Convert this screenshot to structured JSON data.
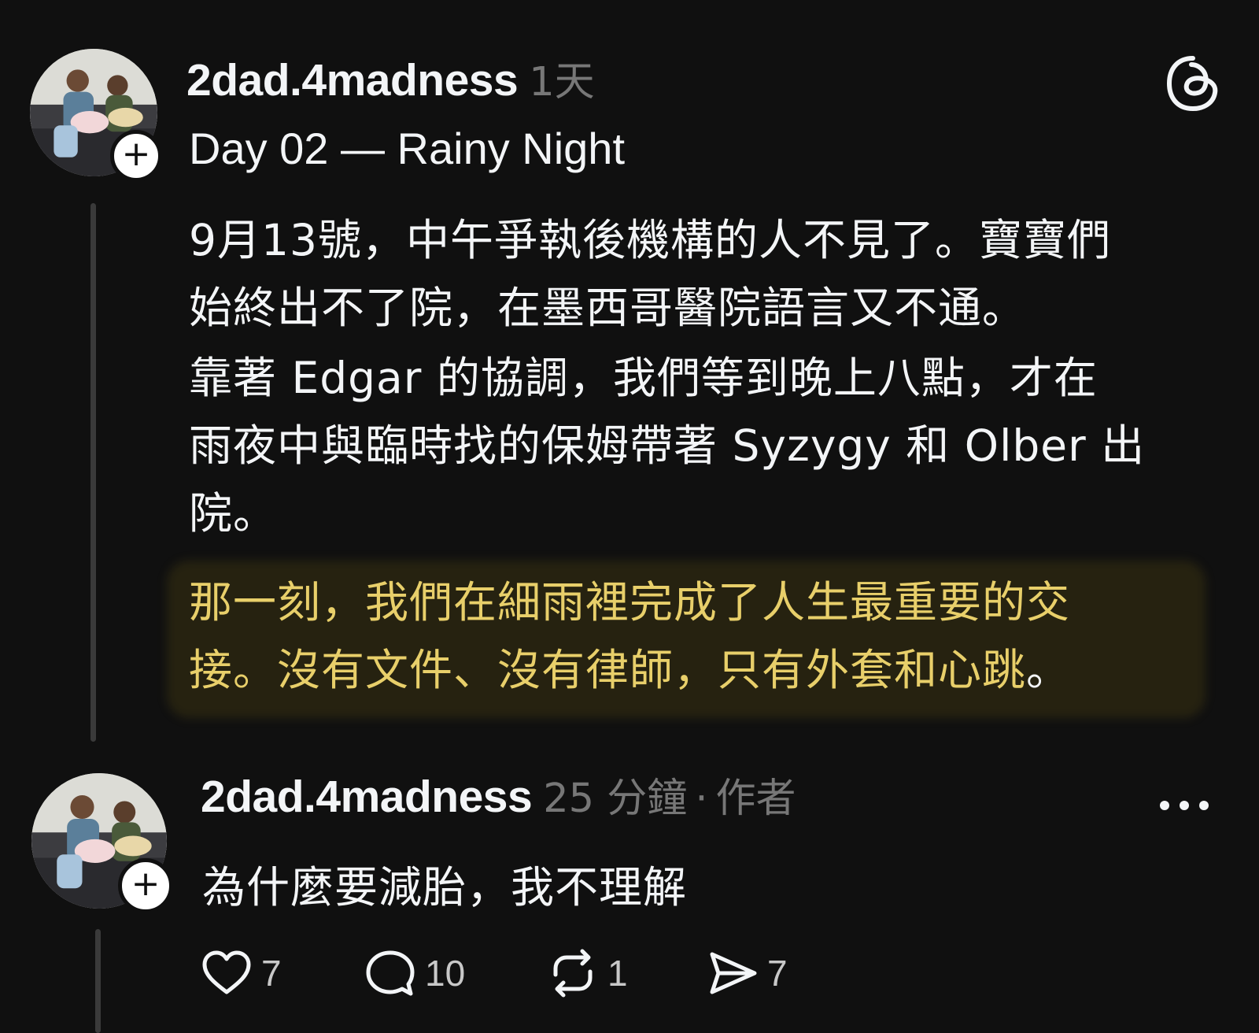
{
  "post": {
    "username": "2dad.4madness",
    "time": "1天",
    "subtitle": "Day 02 — Rainy Night",
    "paragraph1_line1": "9月13號，中午爭執後機構的人不見了。寶寶們",
    "paragraph1_line2": "始終出不了院，在墨西哥醫院語言又不通。",
    "paragraph2_line1": "靠著 Edgar 的協調，我們等到晚上八點，才在",
    "paragraph2_line2": "雨夜中與臨時找的保姆帶著 Syzygy 和 Olber 出",
    "paragraph2_line3": "院。",
    "highlight_line1": "那一刻，我們在細雨裡完成了人生最重要的交",
    "highlight_line2": "接。沒有文件、沒有律師，只有外套和心跳",
    "highlight_line2_end": "。",
    "logo_icon": "threads-logo-icon"
  },
  "reply": {
    "username": "2dad.4madness",
    "time": "25 分鐘",
    "separator": "·",
    "role": "作者",
    "text": "為什麼要減胎，我不理解",
    "more_icon": "more-options-icon"
  },
  "follow_badge_label": "+",
  "actions": {
    "likes": "7",
    "comments": "10",
    "reposts": "1",
    "shares": "7"
  },
  "colors": {
    "background": "#101010",
    "text": "#f3f5f7",
    "muted": "#777777",
    "highlight": "#e8cf6a"
  }
}
